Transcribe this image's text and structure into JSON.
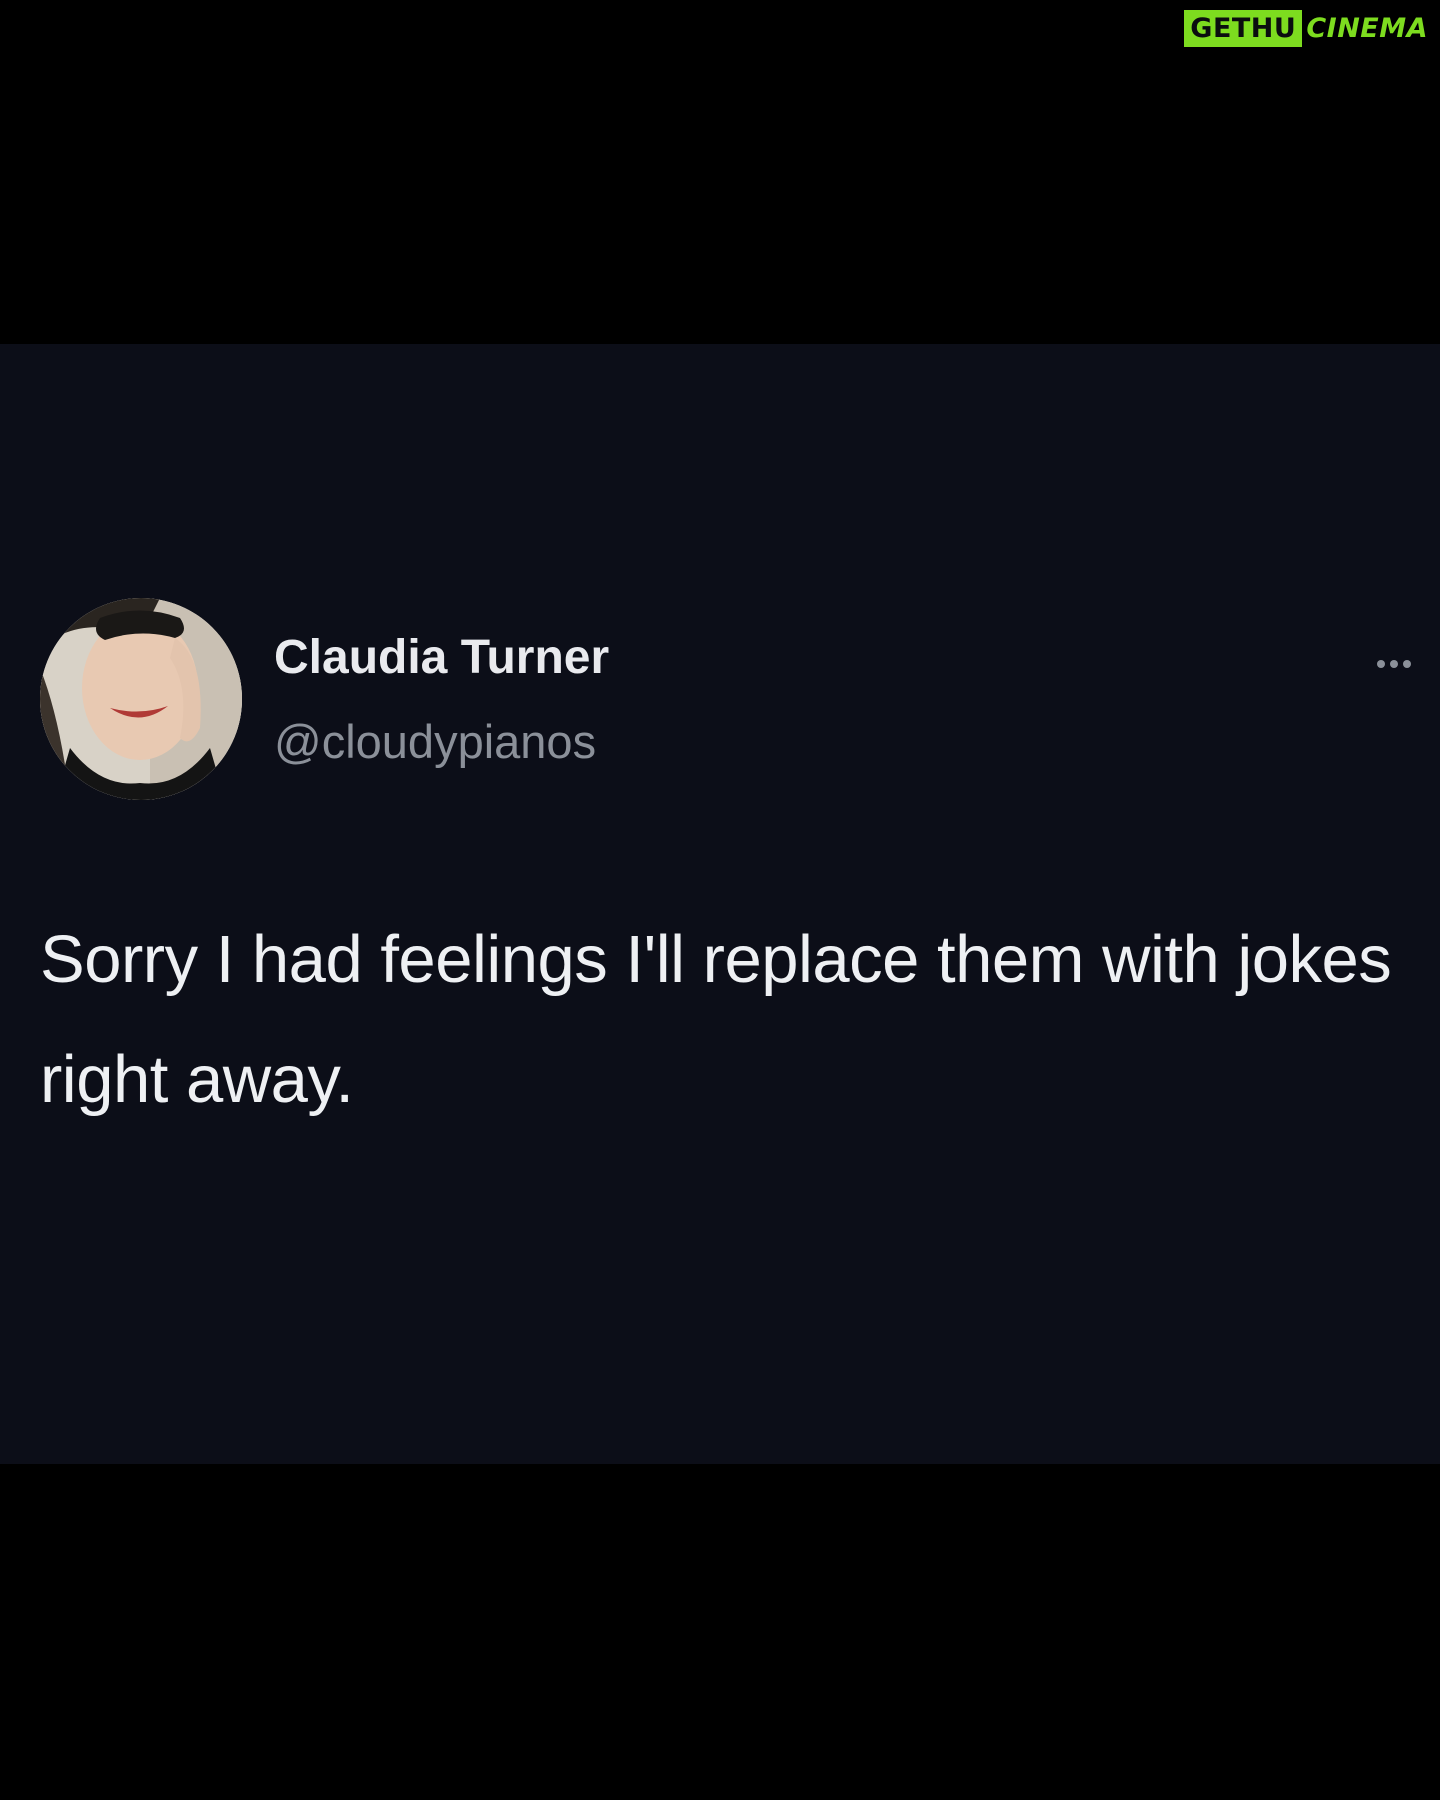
{
  "watermark": {
    "left_text": "GETHU",
    "right_text": "CINEMA",
    "color": "#7ddc1f"
  },
  "tweet": {
    "author": {
      "display_name": "Claudia Turner",
      "handle": "@cloudypianos"
    },
    "text": "Sorry I had feelings I'll replace them with jokes right away.",
    "more_icon": "more-horizontal-icon"
  },
  "colors": {
    "page_background": "#000000",
    "card_background": "#0c0e18",
    "primary_text": "#eef0f3",
    "secondary_text": "#8b9099"
  }
}
